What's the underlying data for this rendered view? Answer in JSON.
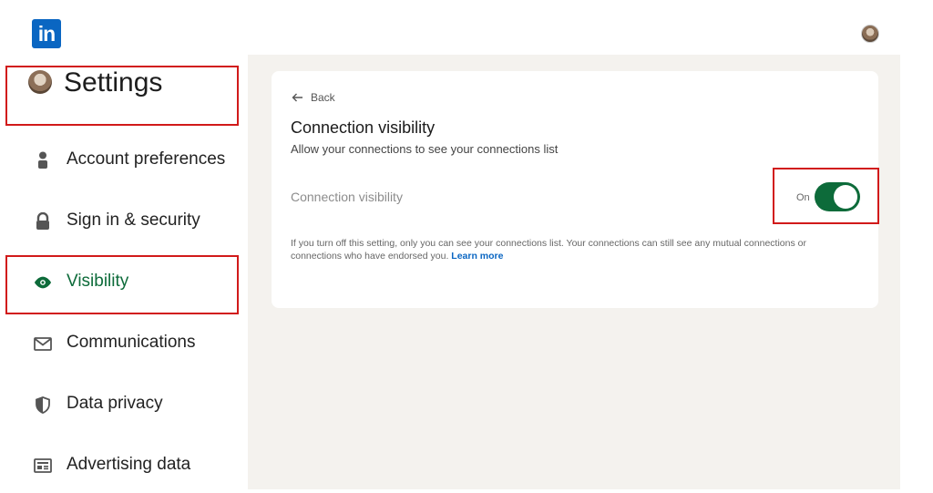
{
  "brand": {
    "logo_text": "in",
    "color": "#0a66c2"
  },
  "sidebar": {
    "title": "Settings",
    "items": [
      {
        "label": "Account preferences",
        "icon": "person-icon"
      },
      {
        "label": "Sign in & security",
        "icon": "lock-icon"
      },
      {
        "label": "Visibility",
        "icon": "eye-icon",
        "active": true
      },
      {
        "label": "Communications",
        "icon": "mail-icon"
      },
      {
        "label": "Data privacy",
        "icon": "shield-icon"
      },
      {
        "label": "Advertising data",
        "icon": "ad-icon"
      }
    ]
  },
  "card": {
    "back_label": "Back",
    "title": "Connection visibility",
    "subtitle": "Allow your connections to see your connections list",
    "setting_label": "Connection visibility",
    "toggle_state": "On",
    "toggle_on": true,
    "note": "If you turn off this setting, only you can see your connections list. Your connections can still see any mutual connections or connections who have endorsed you.",
    "learn_more": "Learn more"
  },
  "colors": {
    "accent_green": "#0d6b3a",
    "highlight_red": "#d11a1a",
    "background": "#f4f2ee"
  }
}
